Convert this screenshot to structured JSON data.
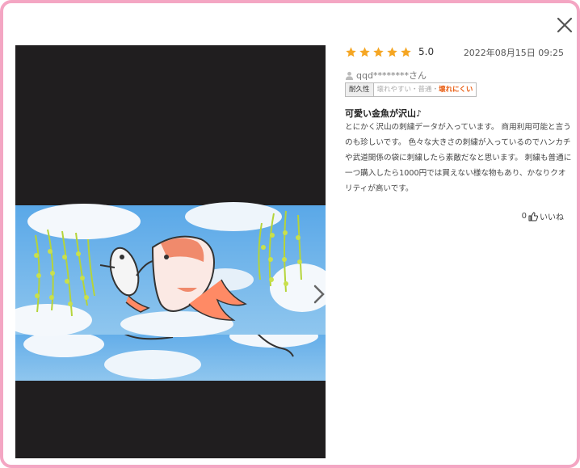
{
  "review": {
    "rating_value": 5,
    "score_text": "5.0",
    "date": "2022年08月15日 09:25",
    "user_name": "qqd********さん",
    "durability": {
      "label": "耐久性",
      "options": [
        "壊れやすい",
        "普通",
        "壊れにくい"
      ],
      "separator": "・",
      "selected_index": 2
    },
    "title": "可愛い金魚が沢山♪",
    "body": "とにかく沢山の刺繍データが入っています。 商用利用可能と言うのも珍しいです。 色々な大きさの刺繍が入っているのでハンカチや武道関係の袋に刺繍したら素敵だなと思います。 刺繍も普通に一つ購入したら1000円では買えない様な物もあり、かなりクオリティが高いです。",
    "helpful_count": "0",
    "helpful_label": "いいね"
  },
  "icons": {
    "close": "close-icon",
    "star": "star-icon",
    "user": "user-icon",
    "thumbs_up": "thumbs-up-icon",
    "next": "chevron-right-icon"
  },
  "colors": {
    "frame_border": "#f4a6c3",
    "star": "#f5a623",
    "selected_durability": "#e8590c",
    "photo_background": "#201e1f",
    "sky": "#8fc6ee"
  }
}
